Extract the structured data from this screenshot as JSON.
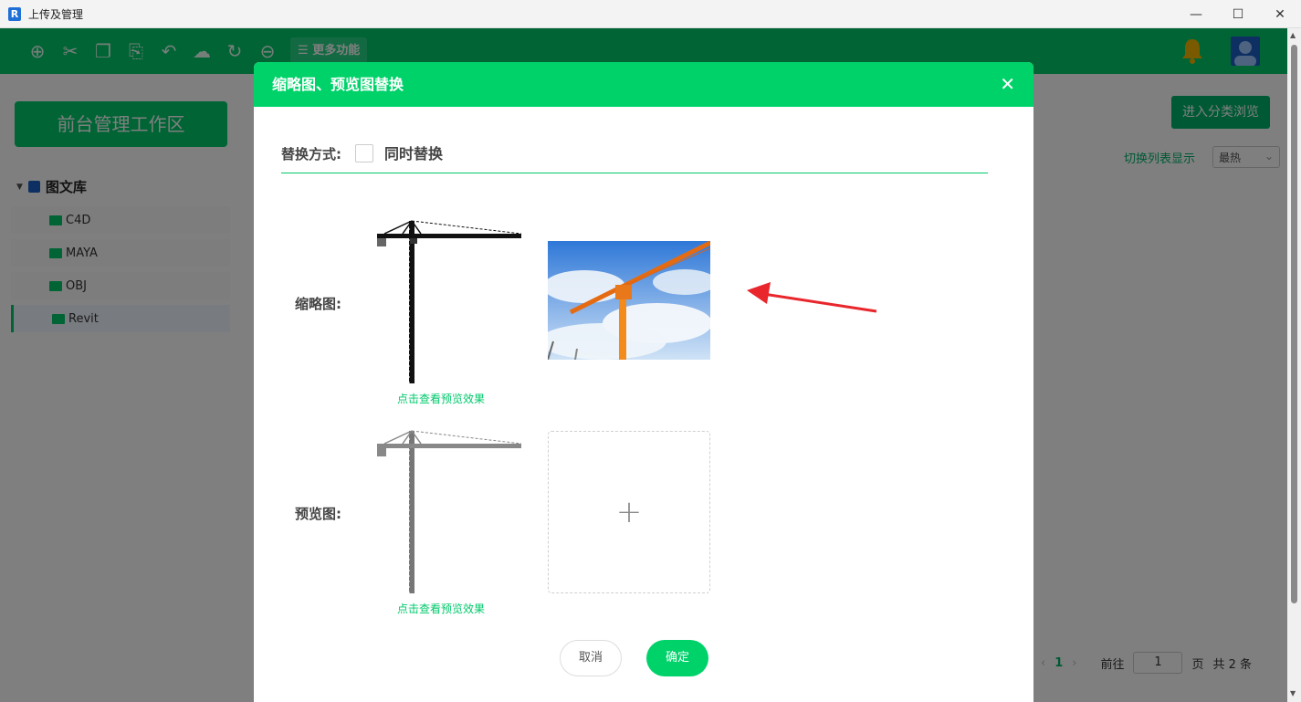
{
  "window": {
    "title": "上传及管理",
    "logo_letter": "R"
  },
  "toolbar": {
    "icons": [
      "add-icon",
      "cut-icon",
      "copy-icon",
      "paste-icon",
      "undo-icon",
      "upload-icon",
      "redo-icon",
      "remove-icon"
    ],
    "more_label": "更多功能"
  },
  "sidebar": {
    "workspace_label": "前台管理工作区",
    "library_label": "图文库",
    "items": [
      {
        "label": "C4D"
      },
      {
        "label": "MAYA"
      },
      {
        "label": "OBJ"
      },
      {
        "label": "Revit"
      }
    ]
  },
  "content": {
    "browse_label": "进入分类浏览",
    "switch_list_label": "切换列表显示",
    "sort_value": "最热",
    "pager": {
      "current": "1",
      "goto_label": "前往",
      "page_input": "1",
      "page_unit": "页",
      "total": "共 2 条"
    }
  },
  "dialog": {
    "title": "缩略图、预览图替换",
    "mode_label": "替换方式:",
    "mode_option": "同时替换",
    "thumbnail_label": "缩略图:",
    "preview_label": "预览图:",
    "preview_link": "点击查看预览效果",
    "cancel_label": "取消",
    "confirm_label": "确定"
  },
  "colors": {
    "accent": "#00c96b",
    "header": "#00d26a",
    "arrow": "#e8262b"
  }
}
